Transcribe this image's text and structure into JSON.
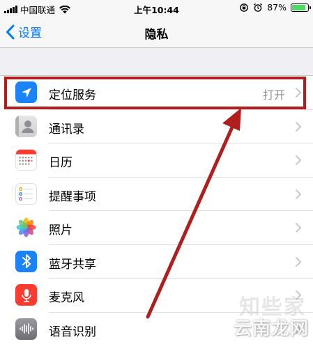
{
  "status_bar": {
    "carrier": "中国联通",
    "time": "上午10:44",
    "battery_percent_text": "87%",
    "battery_level": 0.87,
    "battery_color": "#4cd964"
  },
  "nav": {
    "back_label": "设置",
    "title": "隐私",
    "accent_color": "#007aff"
  },
  "rows": [
    {
      "label": "定位服务",
      "value": "打开",
      "icon": "location-arrow-icon",
      "icon_color": "#1a82fb"
    },
    {
      "label": "通讯录",
      "value": "",
      "icon": "contacts-icon",
      "icon_color": "#e2e2e2"
    },
    {
      "label": "日历",
      "value": "",
      "icon": "calendar-icon",
      "icon_color": "#ffffff"
    },
    {
      "label": "提醒事项",
      "value": "",
      "icon": "reminders-icon",
      "icon_color": "#ffffff"
    },
    {
      "label": "照片",
      "value": "",
      "icon": "photos-icon",
      "icon_color": "#ffffff"
    },
    {
      "label": "蓝牙共享",
      "value": "",
      "icon": "bluetooth-icon",
      "icon_color": "#1a82fb"
    },
    {
      "label": "麦克风",
      "value": "",
      "icon": "microphone-icon",
      "icon_color": "#ff3b30"
    },
    {
      "label": "语音识别",
      "value": "",
      "icon": "speech-recognition-icon",
      "icon_color": "#8e8e93"
    }
  ],
  "annotation": {
    "color": "#b01e1e"
  },
  "watermark": {
    "text": "云南龙网",
    "ghost_text": "知些家"
  }
}
